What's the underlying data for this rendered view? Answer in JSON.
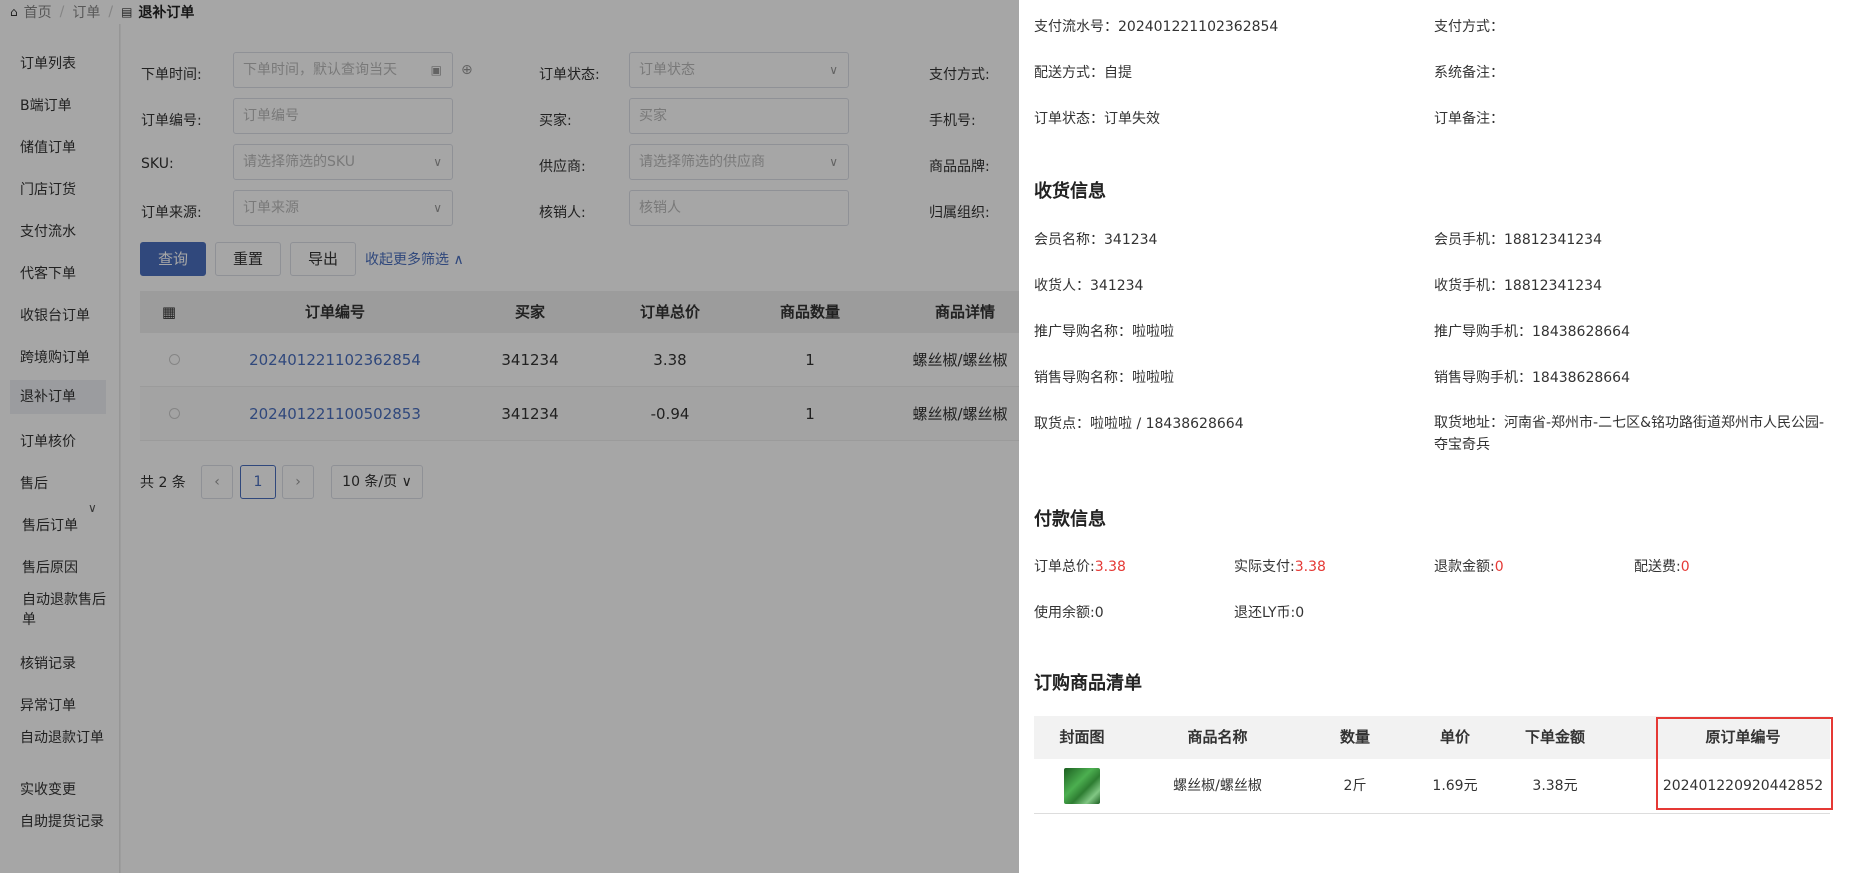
{
  "breadcrumb": {
    "home": "首页",
    "level1": "订单",
    "current": "退补订单"
  },
  "sidebar": {
    "items": [
      "订单列表",
      "B端订单",
      "储值订单",
      "门店订货",
      "支付流水",
      "代客下单",
      "收银台订单",
      "跨境购订单",
      "退补订单",
      "订单核价",
      "售后"
    ],
    "subitems": [
      "售后订单",
      "售后原因",
      "自动退款售后单"
    ],
    "items2": [
      "核销记录",
      "异常订单",
      "自动退款订单",
      "实收变更",
      "自助提货记录"
    ]
  },
  "filters": {
    "order_time_label": "下单时间:",
    "order_time_placeholder": "下单时间，默认查询当天",
    "order_status_label": "订单状态:",
    "order_status_placeholder": "订单状态",
    "pay_method_label": "支付方式:",
    "order_no_label": "订单编号:",
    "order_no_placeholder": "订单编号",
    "buyer_label": "买家:",
    "buyer_placeholder": "买家",
    "phone_label": "手机号:",
    "sku_label": "SKU:",
    "sku_placeholder": "请选择筛选的SKU",
    "supplier_label": "供应商:",
    "supplier_placeholder": "请选择筛选的供应商",
    "brand_label": "商品品牌:",
    "source_label": "订单来源:",
    "source_placeholder": "订单来源",
    "verifier_label": "核销人:",
    "verifier_placeholder": "核销人",
    "org_label": "归属组织:"
  },
  "actions": {
    "query": "查询",
    "reset": "重置",
    "export": "导出",
    "collapse": "收起更多筛选"
  },
  "table": {
    "columns": [
      "订单编号",
      "买家",
      "订单总价",
      "商品数量",
      "商品详情"
    ],
    "rows": [
      {
        "order_no": "202401221102362854",
        "buyer": "341234",
        "total": "3.38",
        "qty": "1",
        "detail": "螺丝椒/螺丝椒"
      },
      {
        "order_no": "202401221100502853",
        "buyer": "341234",
        "total": "-0.94",
        "qty": "1",
        "detail": "螺丝椒/螺丝椒"
      }
    ]
  },
  "pager": {
    "total_text": "共 2 条",
    "current_page": "1",
    "page_size": "10 条/页"
  },
  "drawer": {
    "pay_serial": "支付流水号：202401221102362854",
    "pay_method": "支付方式：",
    "delivery": "配送方式：自提",
    "system_note": "系统备注：",
    "order_status": "订单状态：订单失效",
    "order_note": "订单备注：",
    "receive_title": "收货信息",
    "member_name": "会员名称：341234",
    "member_phone": "会员手机：18812341234",
    "receiver": "收货人：341234",
    "receiver_phone": "收货手机：18812341234",
    "promoter_name": "推广导购名称：啦啦啦",
    "promoter_phone": "推广导购手机：18438628664",
    "sales_name": "销售导购名称：啦啦啦",
    "sales_phone": "销售导购手机：18438628664",
    "pickup_point": "取货点：啦啦啦 / 18438628664",
    "pickup_address": "取货地址：河南省-郑州市-二七区&铭功路街道郑州市人民公园-夺宝奇兵",
    "payment_title": "付款信息",
    "total_label": "订单总价:",
    "total_value": "3.38",
    "actual_label": "实际支付:",
    "actual_value": "3.38",
    "refund_label": "退款金额:",
    "refund_value": "0",
    "shipping_label": "配送费:",
    "shipping_value": "0",
    "balance": "使用余额:0",
    "ly_coin": "退还LY币:0",
    "goods_title": "订购商品清单",
    "goods_columns": [
      "封面图",
      "商品名称",
      "数量",
      "单价",
      "下单金额",
      "原订单编号"
    ],
    "goods_rows": [
      {
        "name": "螺丝椒/螺丝椒",
        "qty": "2斤",
        "price": "1.69元",
        "amount": "3.38元",
        "orig_order": "202401220920442852"
      }
    ]
  },
  "colors": {
    "primary": "#4a6fbf",
    "red": "#e53935"
  }
}
